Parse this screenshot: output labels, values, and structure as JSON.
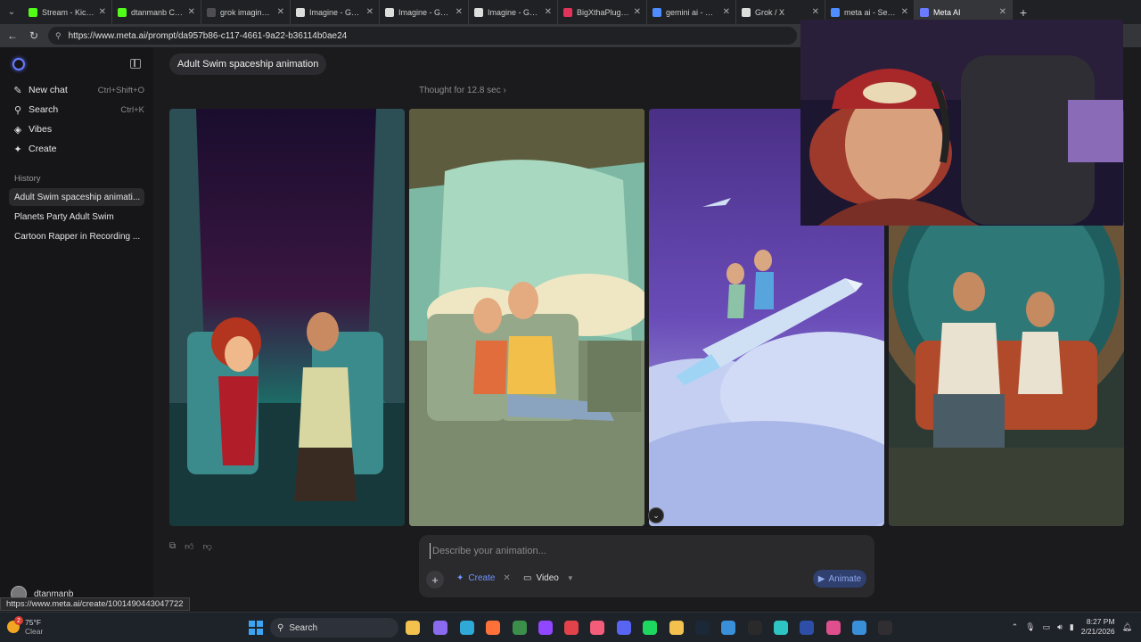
{
  "browser": {
    "tabs": [
      {
        "title": "Stream - Kick Das",
        "favicon_color": "#53fc18",
        "active": false
      },
      {
        "title": "dtanmanb Clips",
        "favicon_color": "#53fc18",
        "active": false
      },
      {
        "title": "grok imagine - Se",
        "favicon_color": "#4e4e52",
        "active": false
      },
      {
        "title": "Imagine - Grok",
        "favicon_color": "#dddddd",
        "active": false
      },
      {
        "title": "Imagine - Grok",
        "favicon_color": "#dddddd",
        "active": false
      },
      {
        "title": "Imagine - Grok",
        "favicon_color": "#dddddd",
        "active": false
      },
      {
        "title": "BigXthaPlug - Bo",
        "favicon_color": "#e2345a",
        "active": false
      },
      {
        "title": "gemini ai - Search",
        "favicon_color": "#4e8cff",
        "active": false
      },
      {
        "title": "Grok / X",
        "favicon_color": "#dddddd",
        "active": false
      },
      {
        "title": "meta ai - Search",
        "favicon_color": "#4e8cff",
        "active": false
      },
      {
        "title": "Meta AI",
        "favicon_color": "#6a7bff",
        "active": true
      }
    ],
    "url": "https://www.meta.ai/prompt/da957b86-c117-4661-9a22-b36114b0ae24",
    "status_url": "https://www.meta.ai/create/1001490443047722"
  },
  "sidebar": {
    "nav": [
      {
        "label": "New chat",
        "shortcut": "Ctrl+Shift+O",
        "icon": "edit-icon"
      },
      {
        "label": "Search",
        "shortcut": "Ctrl+K",
        "icon": "search-icon"
      },
      {
        "label": "Vibes",
        "shortcut": "",
        "icon": "vibes-icon"
      },
      {
        "label": "Create",
        "shortcut": "",
        "icon": "sparkle-icon"
      }
    ],
    "history_heading": "History",
    "history": [
      {
        "label": "Adult Swim spaceship animati...",
        "active": true
      },
      {
        "label": "Planets Party Adult Swim",
        "active": false
      },
      {
        "label": "Cartoon Rapper in Recording ...",
        "active": false
      }
    ],
    "user_name": "dtanmanb"
  },
  "main": {
    "prompt": "Adult Swim spaceship animation",
    "thought": "Thought for 12.8 sec",
    "images": [
      {
        "name": "image-couple-cockpit-red-dress"
      },
      {
        "name": "image-couple-spaceship-window"
      },
      {
        "name": "image-couple-riding-rocket"
      },
      {
        "name": "image-couple-porthole"
      }
    ]
  },
  "composer": {
    "placeholder": "Describe your animation...",
    "create_label": "Create",
    "video_label": "Video",
    "animate_label": "Animate"
  },
  "taskbar": {
    "weather_temp": "75°F",
    "weather_desc": "Clear",
    "notification_count": "2",
    "search_label": "Search",
    "time": "8:27 PM",
    "date": "2/21/2026"
  },
  "colors": {
    "accent": "#6e95ff",
    "background": "#1b1b1d",
    "sidebar": "#161618"
  }
}
